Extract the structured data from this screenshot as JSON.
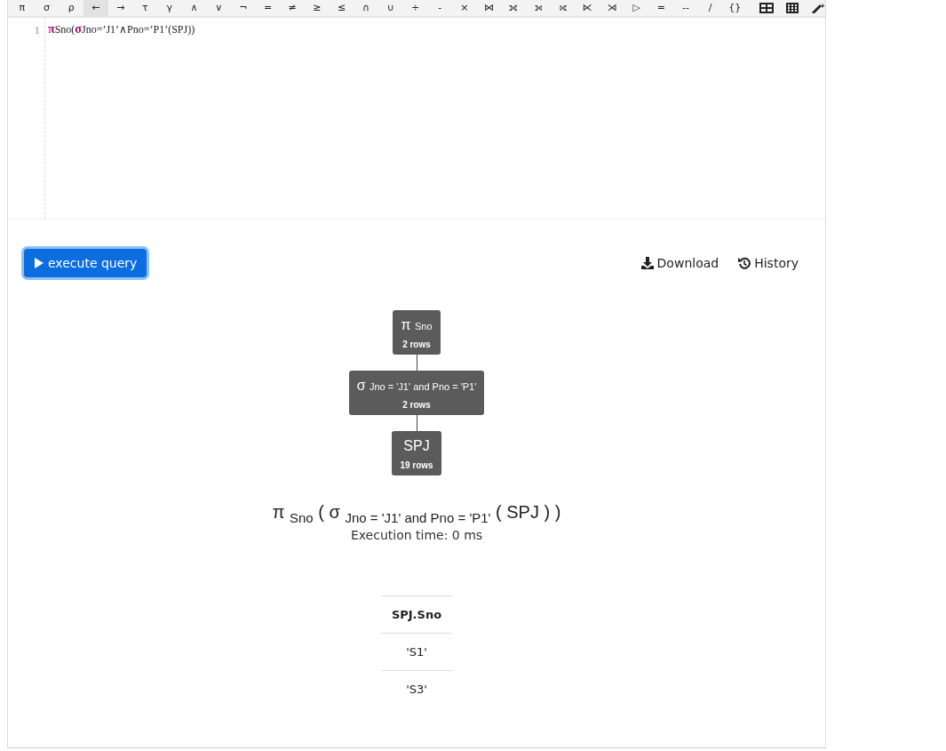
{
  "toolbar": [
    {
      "label": "π",
      "selected": false
    },
    {
      "label": "σ",
      "selected": false
    },
    {
      "label": "ρ",
      "selected": false
    },
    {
      "label": "←",
      "selected": true
    },
    {
      "label": "→",
      "selected": false
    },
    {
      "label": "τ",
      "selected": false
    },
    {
      "label": "γ",
      "selected": false
    },
    {
      "label": "∧",
      "selected": false
    },
    {
      "label": "∨",
      "selected": false
    },
    {
      "label": "¬",
      "selected": false
    },
    {
      "label": "=",
      "selected": false
    },
    {
      "label": "≠",
      "selected": false
    },
    {
      "label": "≥",
      "selected": false
    },
    {
      "label": "≤",
      "selected": false
    },
    {
      "label": "∩",
      "selected": false
    },
    {
      "label": "∪",
      "selected": false
    },
    {
      "label": "÷",
      "selected": false
    },
    {
      "label": "-",
      "selected": false
    },
    {
      "label": "×",
      "selected": false
    },
    {
      "label": "⋈",
      "selected": false
    },
    {
      "label": "⟗",
      "selected": false
    },
    {
      "label": "⟕",
      "selected": false
    },
    {
      "label": "⟖",
      "selected": false
    },
    {
      "label": "⋉",
      "selected": false
    },
    {
      "label": "⋊",
      "selected": false
    },
    {
      "label": "▷",
      "selected": false
    },
    {
      "label": "=",
      "selected": false
    },
    {
      "label": "--",
      "selected": false
    },
    {
      "label": "/",
      "selected": false
    },
    {
      "label": "{}",
      "selected": false
    }
  ],
  "editor": {
    "lines": [
      {
        "number": "1",
        "segments": [
          {
            "text": "π",
            "kind": "operator"
          },
          {
            "text": "Sno(",
            "kind": "plain"
          },
          {
            "text": "σ",
            "kind": "operator"
          },
          {
            "text": "Jno=’J1’∧Pno=’P1’(SPJ))",
            "kind": "plain"
          }
        ]
      }
    ]
  },
  "execute_button": "execute query",
  "actions": [
    {
      "label": "Download",
      "kind": "download"
    },
    {
      "label": "History",
      "kind": "history"
    }
  ],
  "tree": [
    {
      "kind": "operator",
      "symbol": "π",
      "condition": "Sno",
      "rows": "2 rows"
    },
    {
      "kind": "operator",
      "symbol": "σ",
      "condition": "Jno = 'J1' and Pno = 'P1'",
      "rows": "2 rows"
    },
    {
      "kind": "relation",
      "name": "SPJ",
      "rows": "19 rows"
    }
  ],
  "expression": "π $_{Sno}$ ( σ $_{Jno = 'J1' and Pno = 'P1'}$ ( SPJ ) )",
  "execution_time": "Execution time: 0 ms",
  "result": {
    "columns": [
      "SPJ.Sno"
    ],
    "rows": [
      [
        "'S1'"
      ],
      [
        "'S3'"
      ]
    ]
  }
}
